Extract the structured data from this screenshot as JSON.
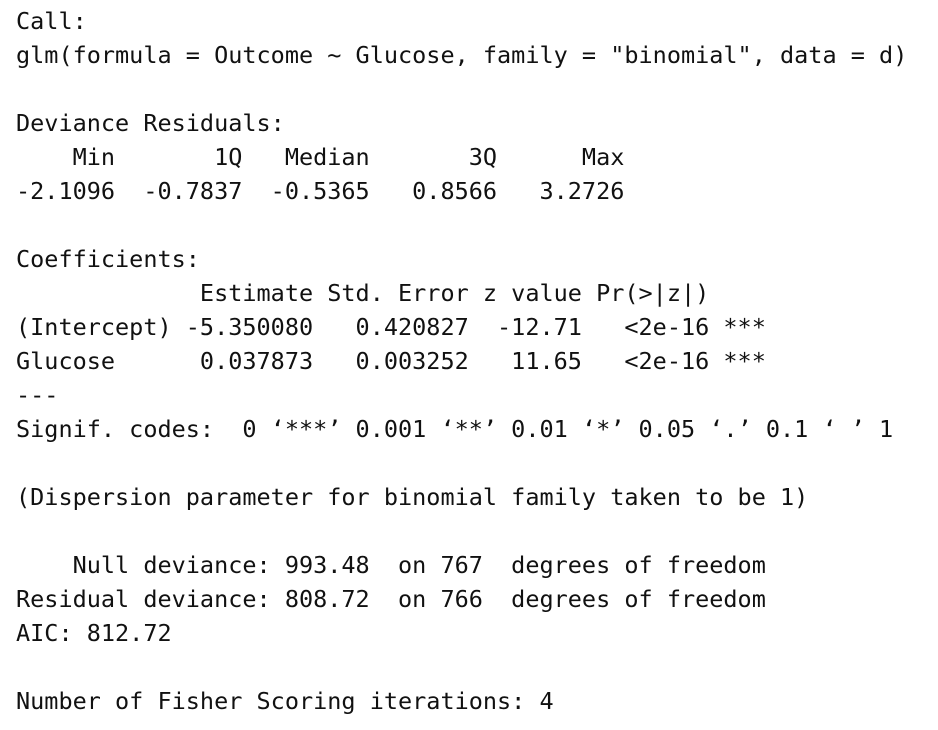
{
  "console": {
    "lines": [
      "Call:",
      "glm(formula = Outcome ~ Glucose, family = \"binomial\", data = d)",
      "",
      "Deviance Residuals:",
      "    Min       1Q   Median       3Q      Max  ",
      "-2.1096  -0.7837  -0.5365   0.8566   3.2726  ",
      "",
      "Coefficients:",
      "             Estimate Std. Error z value Pr(>|z|)    ",
      "(Intercept) -5.350080   0.420827  -12.71   <2e-16 ***",
      "Glucose      0.037873   0.003252   11.65   <2e-16 ***",
      "---",
      "Signif. codes:  0 ‘***’ 0.001 ‘**’ 0.01 ‘*’ 0.05 ‘.’ 0.1 ‘ ’ 1",
      "",
      "(Dispersion parameter for binomial family taken to be 1)",
      "",
      "    Null deviance: 993.48  on 767  degrees of freedom",
      "Residual deviance: 808.72  on 766  degrees of freedom",
      "AIC: 812.72",
      "",
      "Number of Fisher Scoring iterations: 4"
    ]
  }
}
